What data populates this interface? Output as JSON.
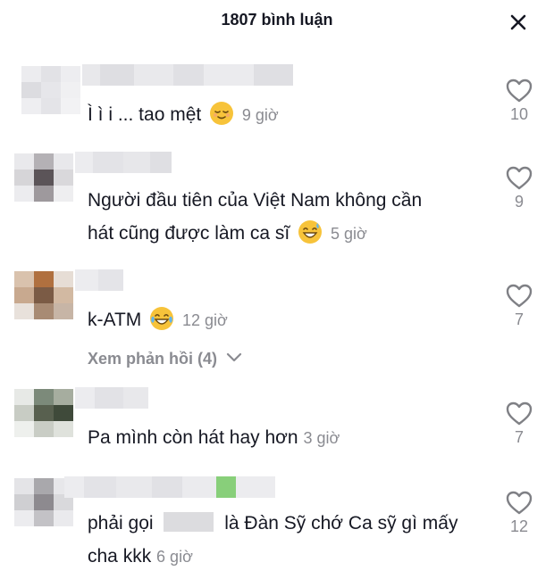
{
  "header": {
    "title": "1807 bình luận",
    "close_icon": "close-icon"
  },
  "comments": [
    {
      "text": "Ì ì i ... tao mệt",
      "emoji": "relieved-face-emoji",
      "time": "9 giờ",
      "likes": "10"
    },
    {
      "text_line1": "Người đầu tiên của Việt Nam không cần",
      "text_line2": "hát cũng được làm ca sĩ",
      "emoji": "grinning-sweat-emoji",
      "time": "5 giờ",
      "likes": "9"
    },
    {
      "text": "k-ATM",
      "emoji": "tears-of-joy-emoji",
      "time": "12 giờ",
      "likes": "7",
      "replies_label": "Xem phản hồi (4)"
    },
    {
      "text": "Pa mình còn hát hay hơn",
      "time": "3 giờ",
      "likes": "7"
    },
    {
      "text_line1_a": "phải gọi",
      "text_line1_b": "là Đàn Sỹ chớ Ca sỹ gì mấy",
      "text_line2": "cha kkk",
      "time": "6 giờ",
      "likes": "12"
    }
  ],
  "colors": {
    "text": "#161823",
    "secondary": "#8a8b91",
    "icon": "#7f8085"
  }
}
